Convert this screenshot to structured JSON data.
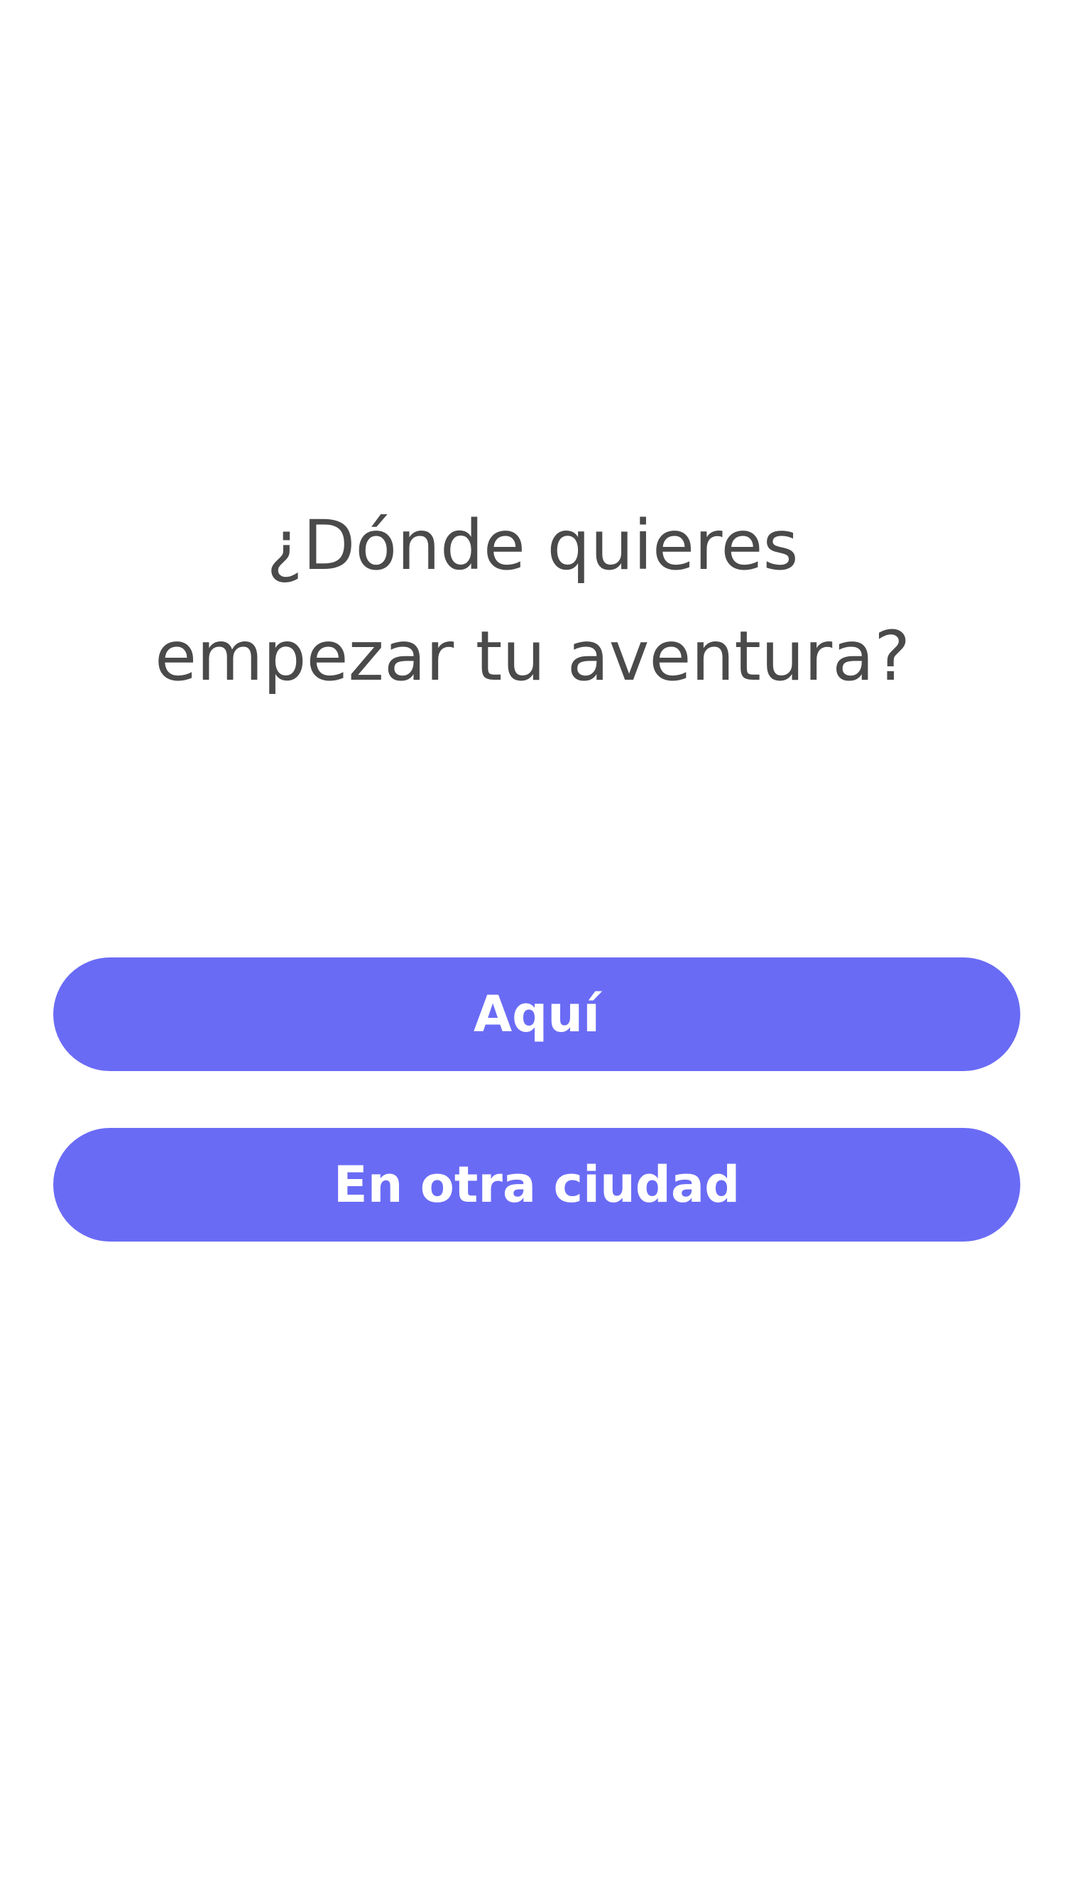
{
  "question": {
    "line1": "¿Dónde quieres",
    "line2": "empezar tu aventura?"
  },
  "buttons": {
    "here_label": "Aquí",
    "other_city_label": "En otra ciudad"
  },
  "colors": {
    "background": "#ffffff",
    "question_text": "#4a4a4a",
    "button_background": "#6a6bf5",
    "button_text": "#ffffff"
  }
}
